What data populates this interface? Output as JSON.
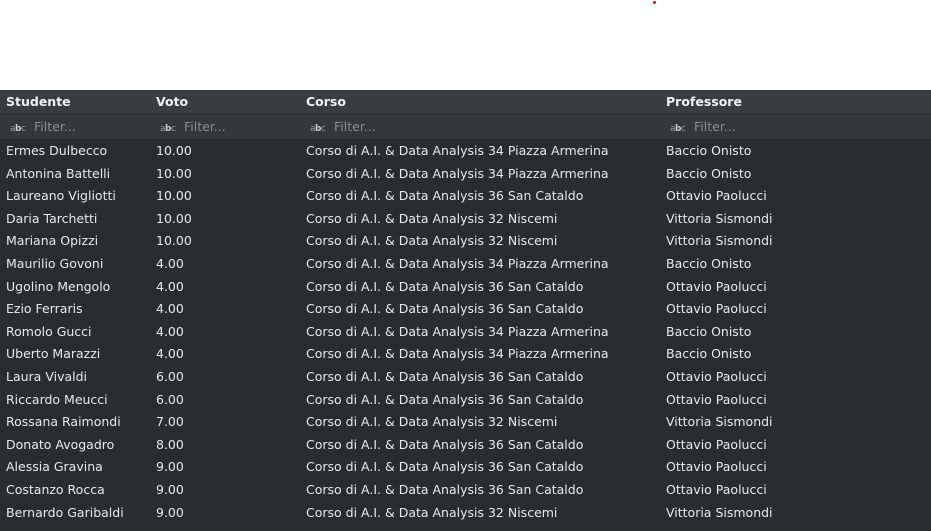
{
  "table": {
    "columns": [
      {
        "label": "Studente"
      },
      {
        "label": "Voto"
      },
      {
        "label": "Corso"
      },
      {
        "label": "Professore"
      }
    ],
    "filter_placeholder": "Filter...",
    "filter_icon": "text-filter-icon",
    "rows": [
      [
        "Ermes Dulbecco",
        "10.00",
        "Corso di A.I. & Data Analysis 34 Piazza Armerina",
        "Baccio Onisto"
      ],
      [
        "Antonina Battelli",
        "10.00",
        "Corso di A.I. & Data Analysis 34 Piazza Armerina",
        "Baccio Onisto"
      ],
      [
        "Laureano Vigliotti",
        "10.00",
        "Corso di A.I. & Data Analysis 36 San Cataldo",
        "Ottavio Paolucci"
      ],
      [
        "Daria Tarchetti",
        "10.00",
        "Corso di A.I. & Data Analysis 32 Niscemi",
        "Vittoria Sismondi"
      ],
      [
        "Mariana Opizzi",
        "10.00",
        "Corso di A.I. & Data Analysis 32 Niscemi",
        "Vittoria Sismondi"
      ],
      [
        "Maurilio Govoni",
        "4.00",
        "Corso di A.I. & Data Analysis 34 Piazza Armerina",
        "Baccio Onisto"
      ],
      [
        "Ugolino Mengolo",
        "4.00",
        "Corso di A.I. & Data Analysis 36 San Cataldo",
        "Ottavio Paolucci"
      ],
      [
        "Ezio Ferraris",
        "4.00",
        "Corso di A.I. & Data Analysis 36 San Cataldo",
        "Ottavio Paolucci"
      ],
      [
        "Romolo Gucci",
        "4.00",
        "Corso di A.I. & Data Analysis 34 Piazza Armerina",
        "Baccio Onisto"
      ],
      [
        "Uberto Marazzi",
        "4.00",
        "Corso di A.I. & Data Analysis 34 Piazza Armerina",
        "Baccio Onisto"
      ],
      [
        "Laura Vivaldi",
        "6.00",
        "Corso di A.I. & Data Analysis 36 San Cataldo",
        "Ottavio Paolucci"
      ],
      [
        "Riccardo Meucci",
        "6.00",
        "Corso di A.I. & Data Analysis 36 San Cataldo",
        "Ottavio Paolucci"
      ],
      [
        "Rossana Raimondi",
        "7.00",
        "Corso di A.I. & Data Analysis 32 Niscemi",
        "Vittoria Sismondi"
      ],
      [
        "Donato Avogadro",
        "8.00",
        "Corso di A.I. & Data Analysis 36 San Cataldo",
        "Ottavio Paolucci"
      ],
      [
        "Alessia Gravina",
        "9.00",
        "Corso di A.I. & Data Analysis 36 San Cataldo",
        "Ottavio Paolucci"
      ],
      [
        "Costanzo Rocca",
        "9.00",
        "Corso di A.I. & Data Analysis 36 San Cataldo",
        "Ottavio Paolucci"
      ],
      [
        "Bernardo Garibaldi",
        "9.00",
        "Corso di A.I. & Data Analysis 32 Niscemi",
        "Vittoria Sismondi"
      ]
    ]
  },
  "colors": {
    "grid_background": "#2a2c2f",
    "header_background": "#3a3d40",
    "filter_background": "#35373a",
    "text": "#e8e8e8",
    "placeholder": "#8b8e92",
    "accent_dot": "#c8102e"
  }
}
